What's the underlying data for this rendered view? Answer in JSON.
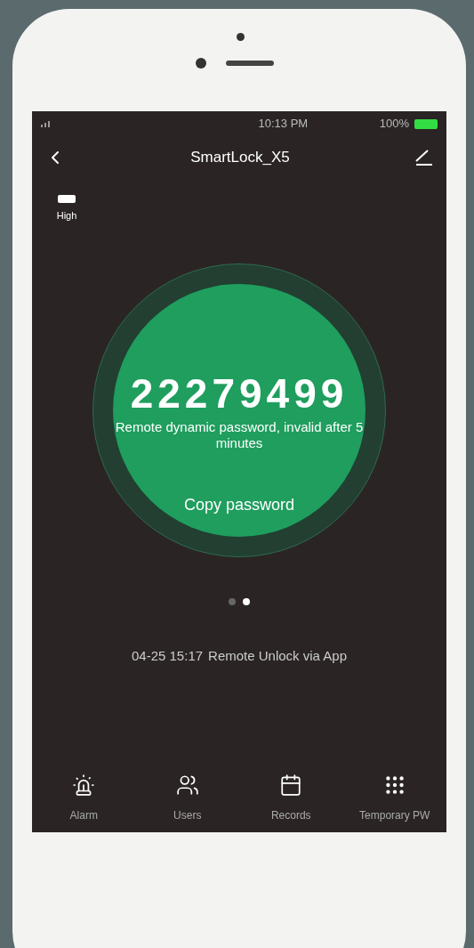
{
  "status_bar": {
    "time": "10:13 PM",
    "battery": "100%"
  },
  "nav": {
    "title": "SmartLock_X5"
  },
  "lock_battery": {
    "label": "High"
  },
  "password": {
    "code": "22279499",
    "note": "Remote dynamic password, invalid after 5 minutes",
    "action": "Copy password"
  },
  "pager": [
    {
      "selected": false
    },
    {
      "selected": true
    }
  ],
  "last_record": {
    "time": "04-25 15:17",
    "event": "Remote Unlock via App"
  },
  "tabs": [
    {
      "kind": "alarm",
      "label": "Alarm"
    },
    {
      "kind": "users",
      "label": "Users"
    },
    {
      "kind": "records",
      "label": "Records"
    },
    {
      "kind": "temporary",
      "label": "Temporary PW"
    }
  ]
}
